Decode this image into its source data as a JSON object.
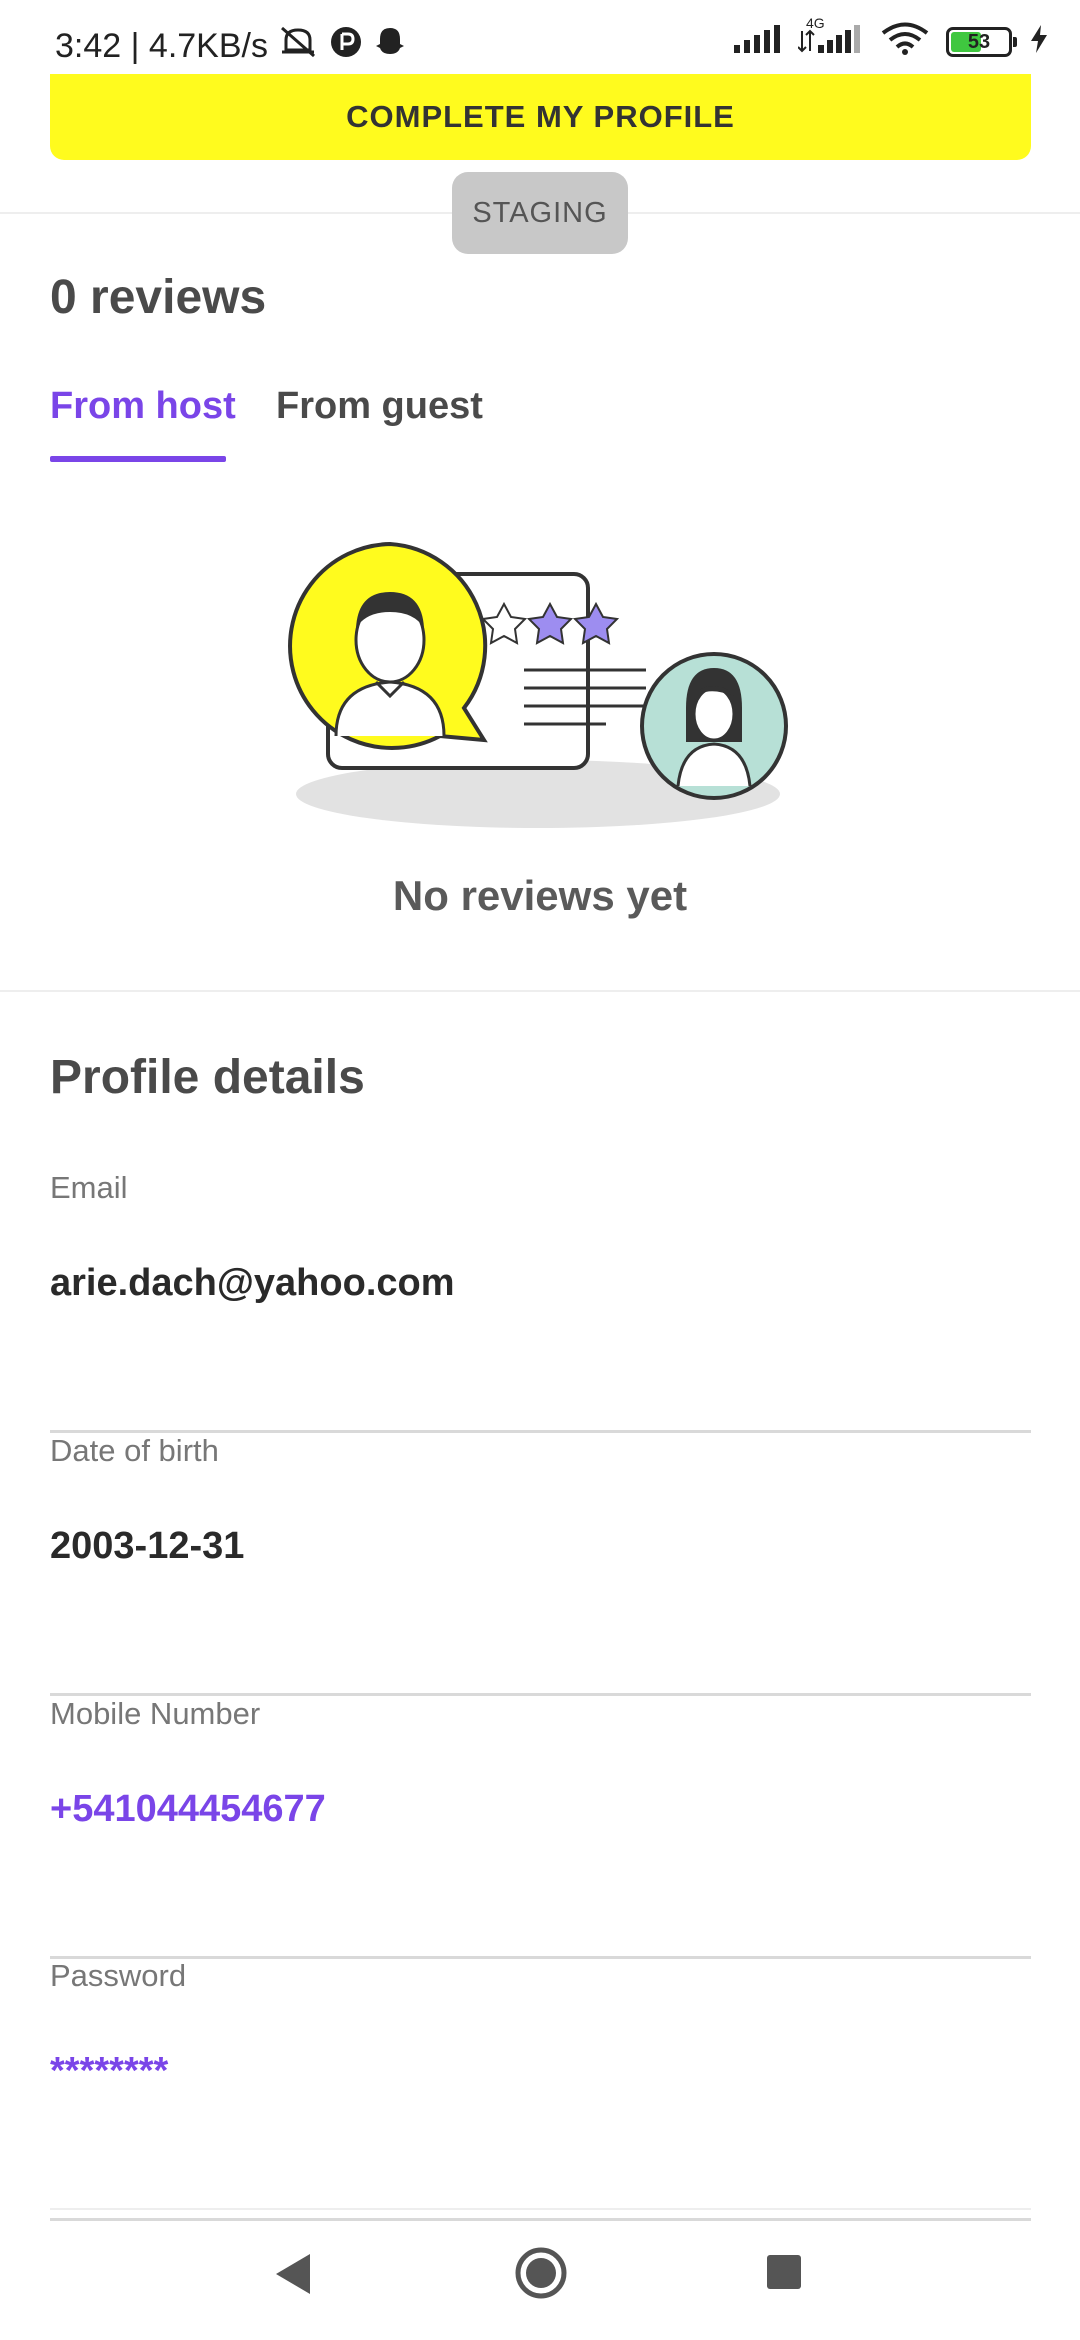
{
  "status_bar": {
    "time": "3:42",
    "speed": "4.7KB/s",
    "network": "4G",
    "battery_level": "53",
    "battery_color": "#3fc73f"
  },
  "banner": {
    "complete_profile_label": "COMPLETE MY PROFILE"
  },
  "env_badge": "STAGING",
  "reviews": {
    "title": "0 reviews",
    "tabs": [
      {
        "label": "From host",
        "selected": true
      },
      {
        "label": "From guest",
        "selected": false
      }
    ],
    "empty_message": "No reviews yet"
  },
  "profile": {
    "title": "Profile details",
    "fields": [
      {
        "label": "Email",
        "value": "arie.dach@yahoo.com"
      },
      {
        "label": "Date of birth",
        "value": "2003-12-31"
      },
      {
        "label": "Mobile Number",
        "value": "+541044454677"
      },
      {
        "label": "Password",
        "value": "********"
      }
    ]
  },
  "colors": {
    "accent": "#7a45e8",
    "banner": "#fffb1e"
  },
  "nav_icons": [
    "back-icon",
    "home-icon",
    "recents-icon"
  ]
}
